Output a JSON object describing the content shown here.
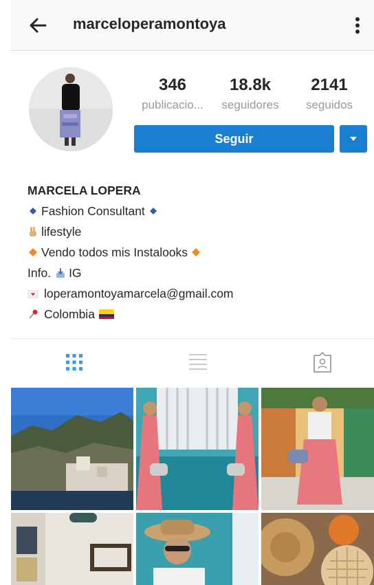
{
  "header": {
    "username": "marceloperamontoya"
  },
  "stats": [
    {
      "value": "346",
      "label": "publicacio..."
    },
    {
      "value": "18.8k",
      "label": "seguidores"
    },
    {
      "value": "2141",
      "label": "seguidos"
    }
  ],
  "actions": {
    "follow_label": "Seguir"
  },
  "bio": {
    "name": "MARCELA LOPERA",
    "line1": "Fashion Consultant",
    "line2": "lifestyle",
    "line3": "Vendo todos mis Instalooks",
    "line4_a": "Info.",
    "line4_b": "IG",
    "email": "loperamontoyamarcela@gmail.com",
    "location": "Colombia"
  },
  "tabs": [
    {
      "icon": "grid-icon",
      "active": true
    },
    {
      "icon": "list-icon",
      "active": false
    },
    {
      "icon": "tagged-icon",
      "active": false
    }
  ],
  "grid_posts": [
    "coastal-village-photo",
    "pink-outfit-mirror-photo",
    "street-pink-skirt-photo",
    "interior-frames-photo",
    "sun-hat-portrait-photo",
    "straw-hat-waffle-photo"
  ],
  "colors": {
    "accent": "#1a7fd1",
    "muted": "#999999",
    "text": "#262626",
    "header_bg": "#fafafa"
  }
}
